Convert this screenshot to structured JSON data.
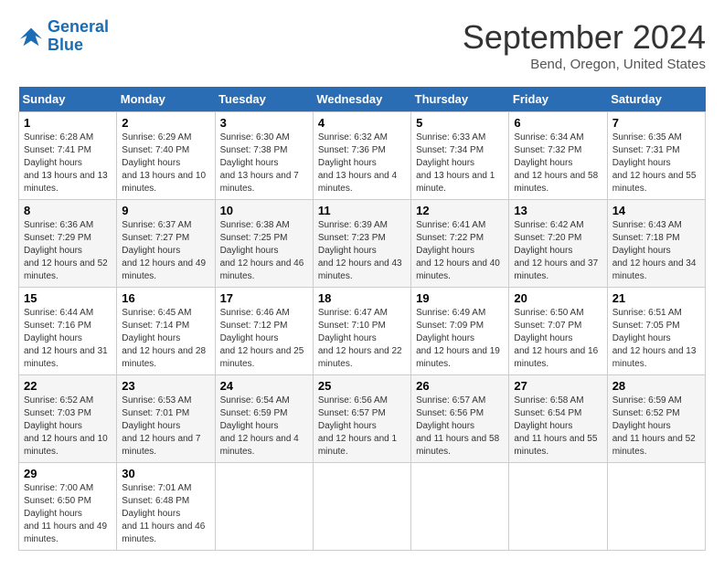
{
  "logo": {
    "line1": "General",
    "line2": "Blue"
  },
  "title": "September 2024",
  "subtitle": "Bend, Oregon, United States",
  "days_header": [
    "Sunday",
    "Monday",
    "Tuesday",
    "Wednesday",
    "Thursday",
    "Friday",
    "Saturday"
  ],
  "weeks": [
    [
      {
        "day": 1,
        "sunrise": "6:28 AM",
        "sunset": "7:41 PM",
        "daylight": "13 hours and 13 minutes."
      },
      {
        "day": 2,
        "sunrise": "6:29 AM",
        "sunset": "7:40 PM",
        "daylight": "13 hours and 10 minutes."
      },
      {
        "day": 3,
        "sunrise": "6:30 AM",
        "sunset": "7:38 PM",
        "daylight": "13 hours and 7 minutes."
      },
      {
        "day": 4,
        "sunrise": "6:32 AM",
        "sunset": "7:36 PM",
        "daylight": "13 hours and 4 minutes."
      },
      {
        "day": 5,
        "sunrise": "6:33 AM",
        "sunset": "7:34 PM",
        "daylight": "13 hours and 1 minute."
      },
      {
        "day": 6,
        "sunrise": "6:34 AM",
        "sunset": "7:32 PM",
        "daylight": "12 hours and 58 minutes."
      },
      {
        "day": 7,
        "sunrise": "6:35 AM",
        "sunset": "7:31 PM",
        "daylight": "12 hours and 55 minutes."
      }
    ],
    [
      {
        "day": 8,
        "sunrise": "6:36 AM",
        "sunset": "7:29 PM",
        "daylight": "12 hours and 52 minutes."
      },
      {
        "day": 9,
        "sunrise": "6:37 AM",
        "sunset": "7:27 PM",
        "daylight": "12 hours and 49 minutes."
      },
      {
        "day": 10,
        "sunrise": "6:38 AM",
        "sunset": "7:25 PM",
        "daylight": "12 hours and 46 minutes."
      },
      {
        "day": 11,
        "sunrise": "6:39 AM",
        "sunset": "7:23 PM",
        "daylight": "12 hours and 43 minutes."
      },
      {
        "day": 12,
        "sunrise": "6:41 AM",
        "sunset": "7:22 PM",
        "daylight": "12 hours and 40 minutes."
      },
      {
        "day": 13,
        "sunrise": "6:42 AM",
        "sunset": "7:20 PM",
        "daylight": "12 hours and 37 minutes."
      },
      {
        "day": 14,
        "sunrise": "6:43 AM",
        "sunset": "7:18 PM",
        "daylight": "12 hours and 34 minutes."
      }
    ],
    [
      {
        "day": 15,
        "sunrise": "6:44 AM",
        "sunset": "7:16 PM",
        "daylight": "12 hours and 31 minutes."
      },
      {
        "day": 16,
        "sunrise": "6:45 AM",
        "sunset": "7:14 PM",
        "daylight": "12 hours and 28 minutes."
      },
      {
        "day": 17,
        "sunrise": "6:46 AM",
        "sunset": "7:12 PM",
        "daylight": "12 hours and 25 minutes."
      },
      {
        "day": 18,
        "sunrise": "6:47 AM",
        "sunset": "7:10 PM",
        "daylight": "12 hours and 22 minutes."
      },
      {
        "day": 19,
        "sunrise": "6:49 AM",
        "sunset": "7:09 PM",
        "daylight": "12 hours and 19 minutes."
      },
      {
        "day": 20,
        "sunrise": "6:50 AM",
        "sunset": "7:07 PM",
        "daylight": "12 hours and 16 minutes."
      },
      {
        "day": 21,
        "sunrise": "6:51 AM",
        "sunset": "7:05 PM",
        "daylight": "12 hours and 13 minutes."
      }
    ],
    [
      {
        "day": 22,
        "sunrise": "6:52 AM",
        "sunset": "7:03 PM",
        "daylight": "12 hours and 10 minutes."
      },
      {
        "day": 23,
        "sunrise": "6:53 AM",
        "sunset": "7:01 PM",
        "daylight": "12 hours and 7 minutes."
      },
      {
        "day": 24,
        "sunrise": "6:54 AM",
        "sunset": "6:59 PM",
        "daylight": "12 hours and 4 minutes."
      },
      {
        "day": 25,
        "sunrise": "6:56 AM",
        "sunset": "6:57 PM",
        "daylight": "12 hours and 1 minute."
      },
      {
        "day": 26,
        "sunrise": "6:57 AM",
        "sunset": "6:56 PM",
        "daylight": "11 hours and 58 minutes."
      },
      {
        "day": 27,
        "sunrise": "6:58 AM",
        "sunset": "6:54 PM",
        "daylight": "11 hours and 55 minutes."
      },
      {
        "day": 28,
        "sunrise": "6:59 AM",
        "sunset": "6:52 PM",
        "daylight": "11 hours and 52 minutes."
      }
    ],
    [
      {
        "day": 29,
        "sunrise": "7:00 AM",
        "sunset": "6:50 PM",
        "daylight": "11 hours and 49 minutes."
      },
      {
        "day": 30,
        "sunrise": "7:01 AM",
        "sunset": "6:48 PM",
        "daylight": "11 hours and 46 minutes."
      },
      null,
      null,
      null,
      null,
      null
    ]
  ]
}
